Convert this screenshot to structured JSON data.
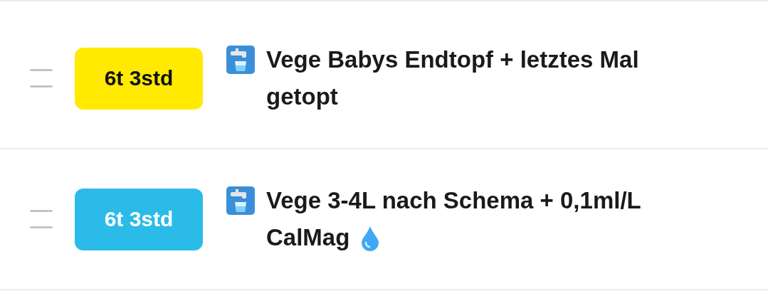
{
  "tasks": [
    {
      "badge": "6t 3std",
      "color": "#ffea00",
      "title": "Vege Babys Endtopf + letztes Mal getopt",
      "trailing_drop": false
    },
    {
      "badge": "6t 3std",
      "color": "#2bbbe8",
      "title": "Vege 3-4L nach Schema + 0,1ml/L CalMag",
      "trailing_drop": true
    }
  ]
}
